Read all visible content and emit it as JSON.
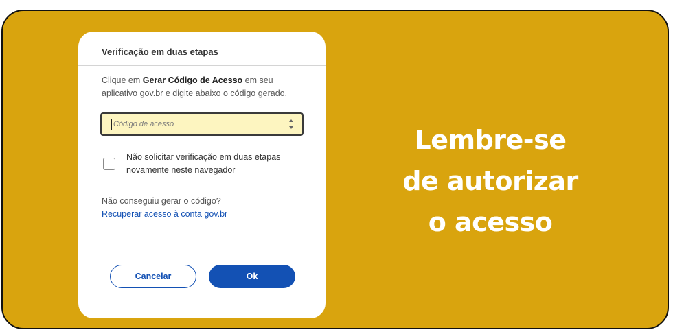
{
  "dialog": {
    "title": "Verificação em duas etapas",
    "description_prefix": "Clique em ",
    "description_bold": "Gerar Código de Acesso",
    "description_suffix": " em seu aplicativo gov.br e digite abaixo o código gerado.",
    "code_input": {
      "placeholder": "Código de acesso",
      "value": ""
    },
    "remember_checkbox": {
      "label": "Não solicitar verificação em duas etapas novamente neste navegador",
      "checked": false
    },
    "help_question": "Não conseguiu gerar o código?",
    "help_link": "Recuperar acesso à conta gov.br",
    "buttons": {
      "cancel": "Cancelar",
      "ok": "Ok"
    }
  },
  "headline": {
    "line1": "Lembre-se",
    "line2": "de autorizar",
    "line3": "o acesso"
  },
  "colors": {
    "background": "#d9a40e",
    "primary_blue": "#1351b4",
    "input_highlight": "#fdf5c0",
    "headline_text": "#ffffff"
  },
  "icons": [
    "spinner-arrows-icon",
    "checkbox-icon"
  ]
}
